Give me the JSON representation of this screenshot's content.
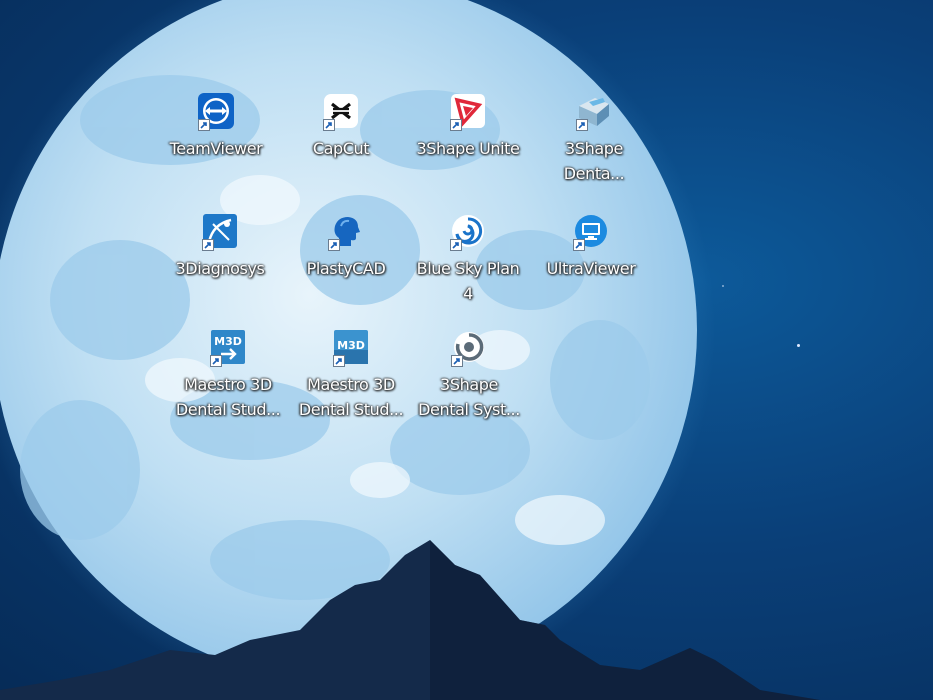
{
  "desktop": {
    "icons": [
      {
        "label": "TeamViewer",
        "icon": "teamviewer-icon"
      },
      {
        "label": "CapCut",
        "icon": "capcut-icon"
      },
      {
        "label": "3Shape Unite",
        "icon": "3shape-unite-icon"
      },
      {
        "label": "3Shape\nDenta...",
        "icon": "3shape-dental-icon"
      },
      {
        "label": "3Diagnosys",
        "icon": "3diagnosys-icon"
      },
      {
        "label": "PlastyCAD",
        "icon": "plastycad-icon"
      },
      {
        "label": "Blue Sky Plan\n4",
        "icon": "blue-sky-plan-icon"
      },
      {
        "label": "UltraViewer",
        "icon": "ultraviewer-icon"
      },
      {
        "label": "Maestro 3D\nDental Stud...",
        "icon": "maestro-3d-icon"
      },
      {
        "label": "Maestro 3D\nDental Stud...",
        "icon": "maestro-3d-icon"
      },
      {
        "label": "3Shape\nDental Syst...",
        "icon": "3shape-dental-system-icon"
      }
    ]
  },
  "colors": {
    "sky": "#0a3f78",
    "moon": "#cfe6f6",
    "mountain": "#142a4a"
  },
  "icon_badges": {
    "maestro_text": "M3D"
  }
}
